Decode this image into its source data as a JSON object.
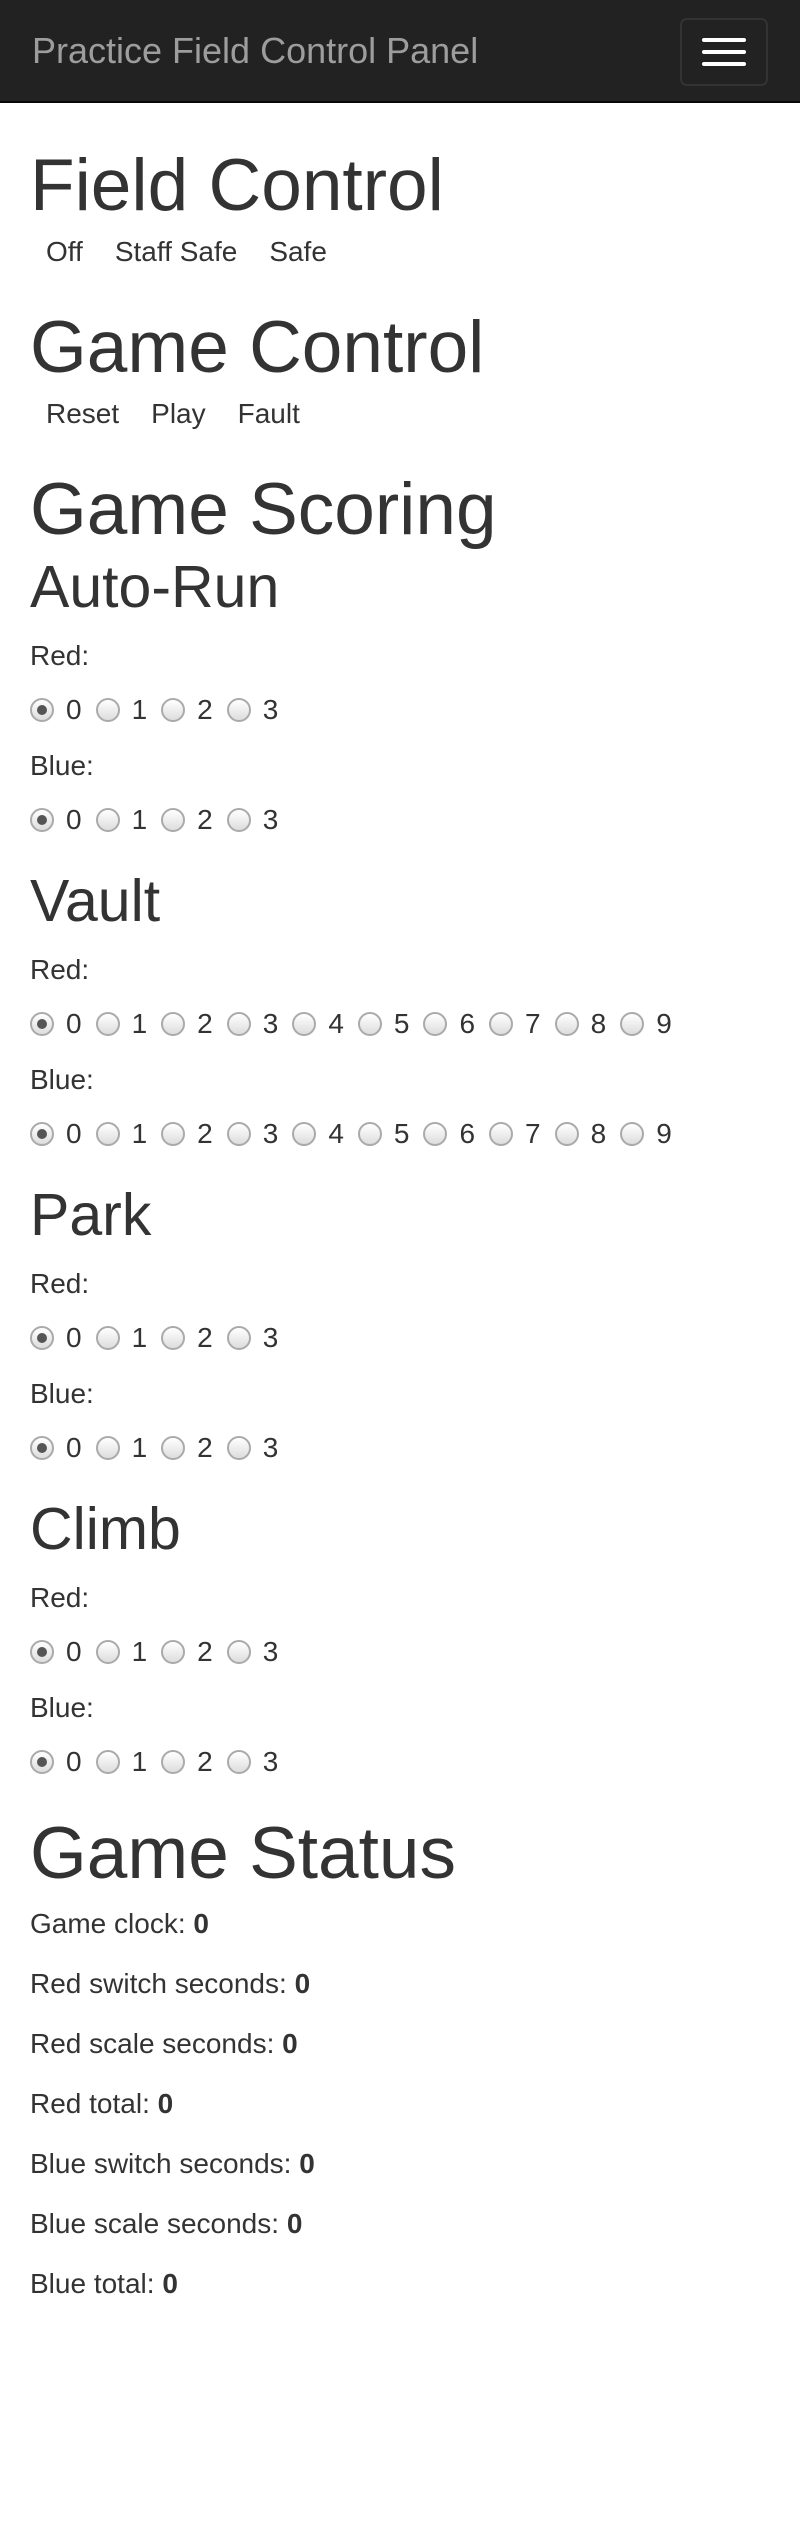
{
  "navbar": {
    "brand": "Practice Field Control Panel"
  },
  "field_control": {
    "heading": "Field Control",
    "buttons": [
      "Off",
      "Staff Safe",
      "Safe"
    ]
  },
  "game_control": {
    "heading": "Game Control",
    "buttons": [
      "Reset",
      "Play",
      "Fault"
    ]
  },
  "game_scoring": {
    "heading": "Game Scoring",
    "sections": [
      {
        "title": "Auto-Run",
        "teams": [
          {
            "label": "Red:",
            "options": [
              "0",
              "1",
              "2",
              "3"
            ],
            "selected": "0"
          },
          {
            "label": "Blue:",
            "options": [
              "0",
              "1",
              "2",
              "3"
            ],
            "selected": "0"
          }
        ]
      },
      {
        "title": "Vault",
        "teams": [
          {
            "label": "Red:",
            "options": [
              "0",
              "1",
              "2",
              "3",
              "4",
              "5",
              "6",
              "7",
              "8",
              "9"
            ],
            "selected": "0"
          },
          {
            "label": "Blue:",
            "options": [
              "0",
              "1",
              "2",
              "3",
              "4",
              "5",
              "6",
              "7",
              "8",
              "9"
            ],
            "selected": "0"
          }
        ]
      },
      {
        "title": "Park",
        "teams": [
          {
            "label": "Red:",
            "options": [
              "0",
              "1",
              "2",
              "3"
            ],
            "selected": "0"
          },
          {
            "label": "Blue:",
            "options": [
              "0",
              "1",
              "2",
              "3"
            ],
            "selected": "0"
          }
        ]
      },
      {
        "title": "Climb",
        "teams": [
          {
            "label": "Red:",
            "options": [
              "0",
              "1",
              "2",
              "3"
            ],
            "selected": "0"
          },
          {
            "label": "Blue:",
            "options": [
              "0",
              "1",
              "2",
              "3"
            ],
            "selected": "0"
          }
        ]
      }
    ]
  },
  "game_status": {
    "heading": "Game Status",
    "game_clock": {
      "label": "Game clock:",
      "value": "0"
    },
    "red_switch": {
      "label": "Red switch seconds:",
      "value": "0"
    },
    "red_scale": {
      "label": "Red scale seconds:",
      "value": "0"
    },
    "red_total": {
      "label": "Red total:",
      "value": "0"
    },
    "blue_switch": {
      "label": "Blue switch seconds:",
      "value": "0"
    },
    "blue_scale": {
      "label": "Blue scale seconds:",
      "value": "0"
    },
    "blue_total": {
      "label": "Blue total:",
      "value": "0"
    }
  }
}
